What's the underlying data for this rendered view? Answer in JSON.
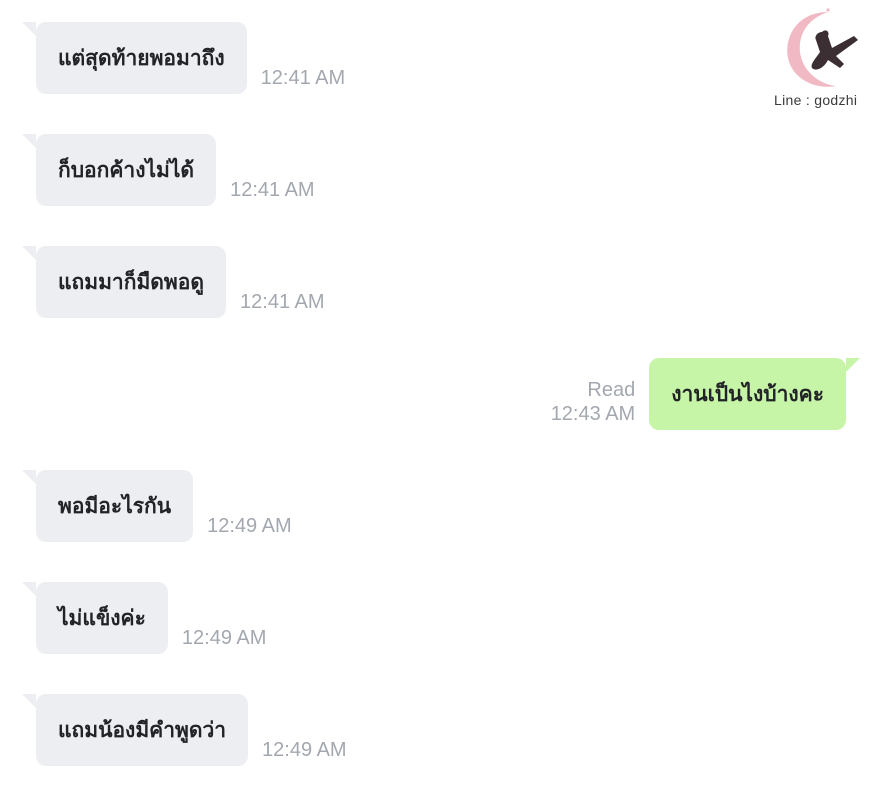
{
  "watermark": {
    "text": "Line : godzhi"
  },
  "messages": [
    {
      "text": "แต่สุดท้ายพอมาถึง",
      "time": "12:41 AM"
    },
    {
      "text": "ก็บอกค้างไม่ได้",
      "time": "12:41 AM"
    },
    {
      "text": "แถมมาก็มืดพอดู",
      "time": "12:41 AM"
    },
    {
      "text": "งานเป็นไงบ้างคะ",
      "time": "12:43 AM",
      "status": "Read"
    },
    {
      "text": "พอมีอะไรกัน",
      "time": "12:49 AM"
    },
    {
      "text": "ไม่แข็งค่ะ",
      "time": "12:49 AM"
    },
    {
      "text": "แถมน้องมีคำพูดว่า",
      "time": "12:49 AM"
    }
  ],
  "colors": {
    "incoming_bubble": "#edeef2",
    "outgoing_bubble": "#c7f5a8",
    "timestamp": "#a3a8b0",
    "text": "#222326"
  }
}
